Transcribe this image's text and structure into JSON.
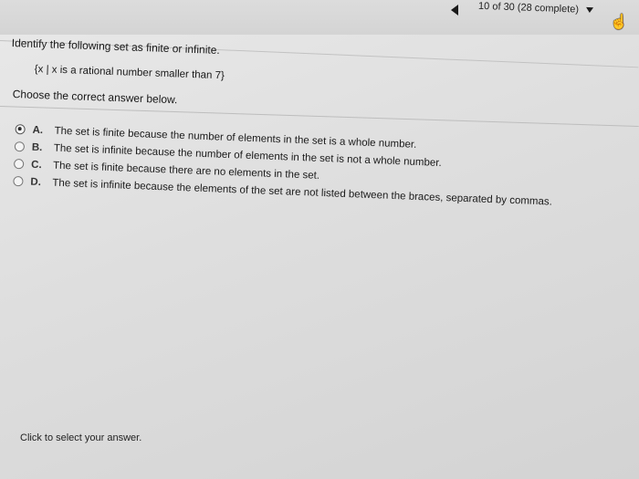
{
  "header": {
    "progress": "10 of 30 (28 complete)"
  },
  "question": {
    "prompt": "Identify the following set as finite or infinite.",
    "set": "{x | x is a rational number smaller than 7}",
    "instruction": "Choose the correct answer below."
  },
  "options": [
    {
      "letter": "A.",
      "text": "The set is finite because the number of elements in the set is a whole number.",
      "selected": true
    },
    {
      "letter": "B.",
      "text": "The set is infinite because the number of elements in the set is not a whole number.",
      "selected": false
    },
    {
      "letter": "C.",
      "text": "The set is finite because there are no elements in the set.",
      "selected": false
    },
    {
      "letter": "D.",
      "text": "The set is infinite because the elements of the set are not listed between the braces, separated by commas.",
      "selected": false
    }
  ],
  "footer": {
    "hint": "Click to select your answer."
  },
  "icons": {
    "prev": "left-triangle-icon",
    "dropdown": "caret-down-icon",
    "pointer": "hand-cursor-icon"
  }
}
